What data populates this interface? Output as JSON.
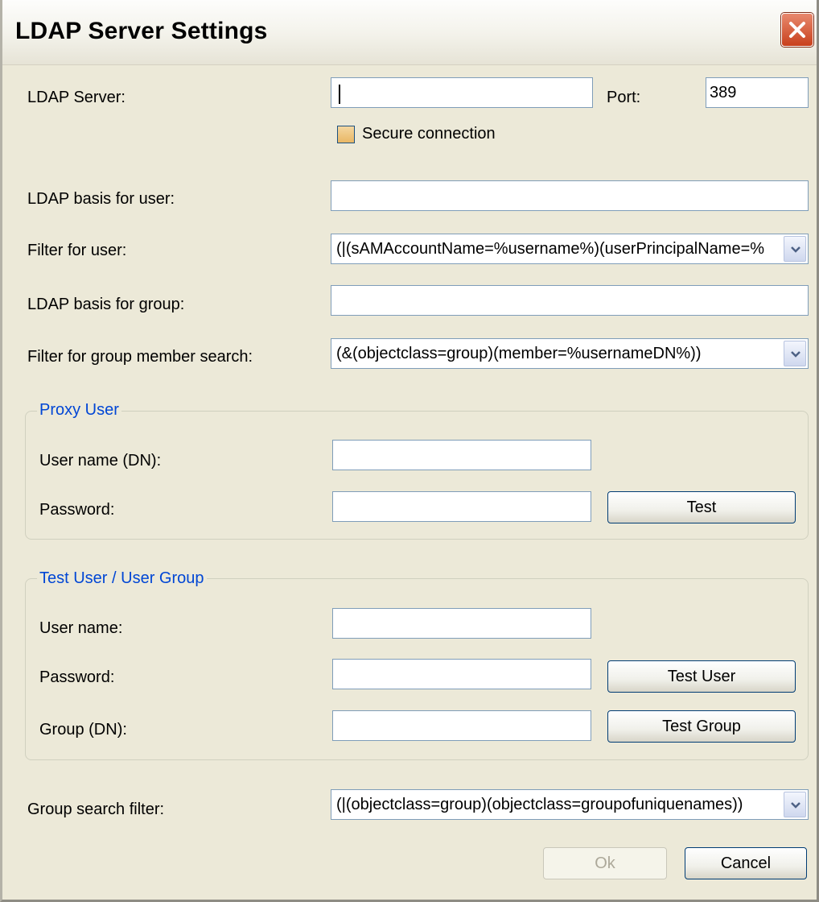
{
  "window": {
    "title": "LDAP Server Settings"
  },
  "server": {
    "label": "LDAP Server:",
    "value": "",
    "port_label": "Port:",
    "port_value": "389",
    "secure_label": "Secure connection",
    "secure_checked": false
  },
  "user_basis": {
    "label": "LDAP basis for user:",
    "value": ""
  },
  "user_filter": {
    "label": "Filter for user:",
    "value": "(|(sAMAccountName=%username%)(userPrincipalName=%"
  },
  "group_basis": {
    "label": "LDAP basis for group:",
    "value": ""
  },
  "group_member_filter": {
    "label": "Filter for group member search:",
    "value": "(&(objectclass=group)(member=%usernameDN%))"
  },
  "proxy_user": {
    "legend": "Proxy User",
    "username_label": "User name (DN):",
    "username_value": "",
    "password_label": "Password:",
    "password_value": "",
    "test_button": "Test"
  },
  "test_user": {
    "legend": "Test User / User Group",
    "username_label": "User name:",
    "username_value": "",
    "password_label": "Password:",
    "password_value": "",
    "group_label": "Group (DN):",
    "group_value": "",
    "test_user_button": "Test User",
    "test_group_button": "Test Group"
  },
  "group_search": {
    "label": "Group search filter:",
    "value": "(|(objectclass=group)(objectclass=groupofuniquenames))"
  },
  "footer": {
    "ok_label": "Ok",
    "ok_enabled": false,
    "cancel_label": "Cancel"
  },
  "colors": {
    "accent_legend": "#0046d5",
    "dialog_bg": "#ece9d8",
    "input_border": "#7f9db9",
    "close_button": "#c8401c"
  },
  "icons": {
    "close": "close-icon",
    "dropdown": "chevron-down-icon"
  }
}
